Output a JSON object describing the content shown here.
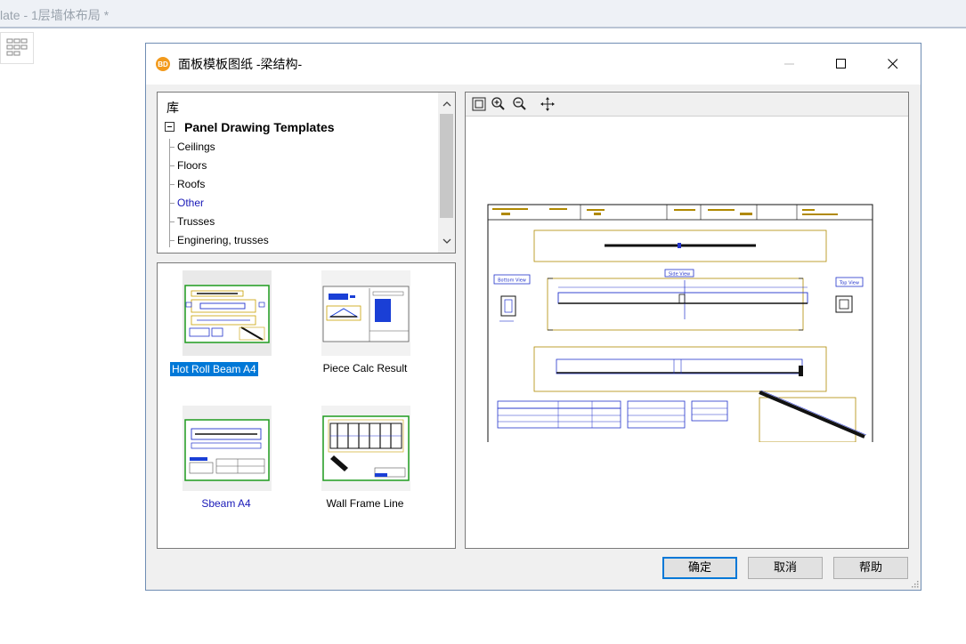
{
  "background": {
    "title": "late - 1层墙体布局 *",
    "grid_icon": "grid-view-icon"
  },
  "dialog": {
    "title": "面板模板图纸  -梁结构-",
    "app_icon_text": "BD",
    "tree": {
      "root": "库",
      "parent": "Panel Drawing Templates",
      "items": [
        {
          "label": "Ceilings"
        },
        {
          "label": "Floors"
        },
        {
          "label": "Roofs"
        },
        {
          "label": "Other",
          "selected": true
        },
        {
          "label": "Trusses"
        },
        {
          "label": "Enginering, trusses"
        }
      ]
    },
    "thumbnails": [
      {
        "label": "Hot Roll Beam A4",
        "selected": true
      },
      {
        "label": "Piece Calc Result"
      },
      {
        "label": "Sbeam A4"
      },
      {
        "label": "Wall Frame Line"
      }
    ],
    "preview": {
      "tools": [
        "zoom-extents-icon",
        "zoom-in-icon",
        "zoom-out-icon",
        "pan-icon"
      ],
      "drawing_labels": {
        "side_view": "Side View",
        "bottom_view": "Bottom View",
        "top_view": "Top View"
      }
    },
    "buttons": {
      "ok": "确定",
      "cancel": "取消",
      "help": "帮助"
    }
  }
}
